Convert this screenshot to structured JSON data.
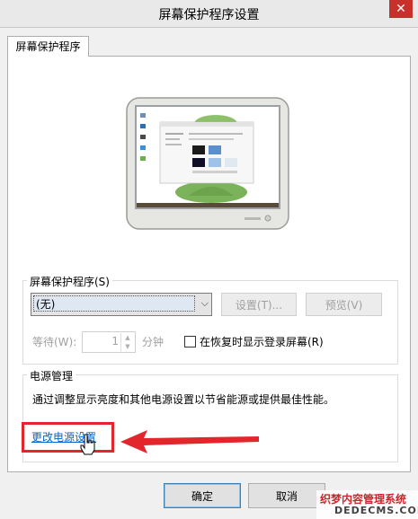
{
  "window": {
    "title": "屏幕保护程序设置",
    "close_symbol": "✕"
  },
  "tab": {
    "label": "屏幕保护程序"
  },
  "screensaver": {
    "group_label": "屏幕保护程序(S)",
    "selected": "(无)",
    "settings_button": "设置(T)...",
    "preview_button": "预览(V)",
    "wait_label": "等待(W):",
    "wait_value": "1",
    "wait_unit": "分钟",
    "resume_label": "在恢复时显示登录屏幕(R)"
  },
  "power": {
    "group_label": "电源管理",
    "description": "通过调整显示亮度和其他电源设置以节省能源或提供最佳性能。",
    "link": "更改电源设置"
  },
  "buttons": {
    "ok": "确定",
    "cancel": "取消"
  },
  "watermark": {
    "line1": "织梦内容管理系统",
    "line2": "DEDECMS.COM"
  },
  "colors": {
    "highlight": "#e3262b",
    "link": "#0066cc",
    "close": "#c7302b"
  }
}
